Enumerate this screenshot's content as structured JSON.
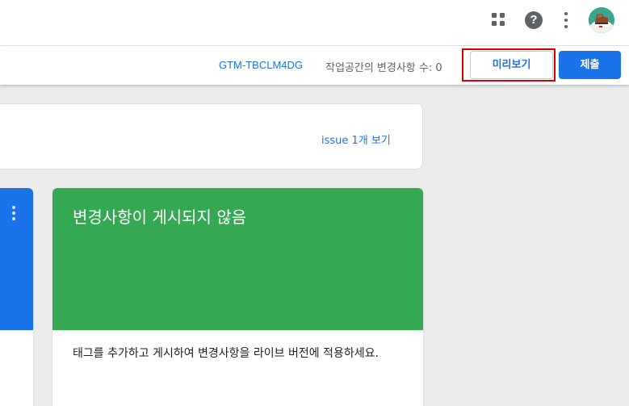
{
  "topbar": {
    "icons": {
      "apps": "apps-grid-icon",
      "help": "help-circle-icon",
      "more": "more-vertical-icon",
      "avatar": "user-avatar"
    },
    "help_glyph": "?"
  },
  "toolbar": {
    "container_id": "GTM-TBCLM4DG",
    "workspace_changes": "작업공간의 변경사항 수: 0",
    "preview_label": "미리보기",
    "submit_label": "제출"
  },
  "issue_card": {
    "link_label": "issue 1개 보기"
  },
  "status_card": {
    "title": "변경사항이 게시되지 않음",
    "description": "태그를 추가하고 게시하여 변경사항을 라이브 버전에 적용하세요."
  },
  "colors": {
    "accent_blue": "#1a73e8",
    "status_green": "#34a853",
    "highlight_red": "#d50000",
    "icon_grey": "#5f6368"
  }
}
